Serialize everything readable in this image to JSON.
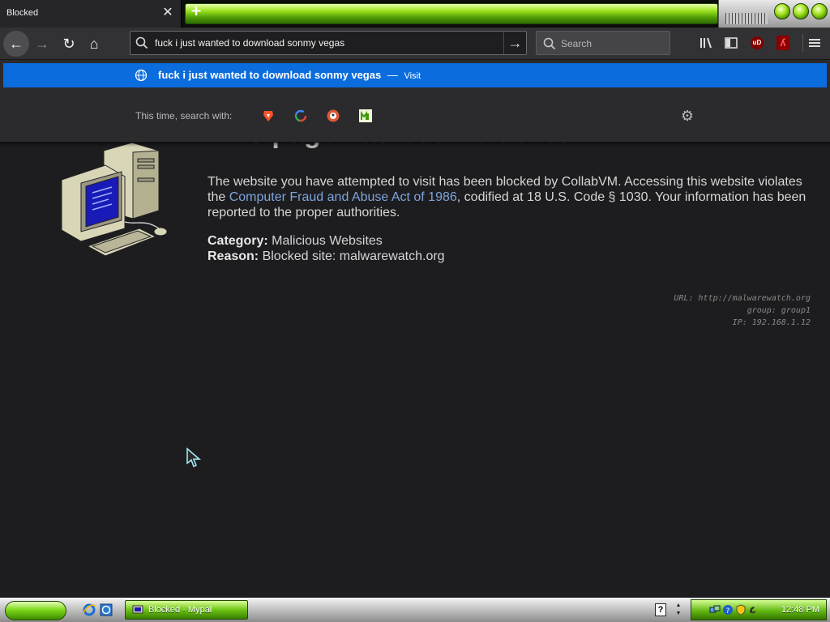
{
  "tab": {
    "title": "Blocked",
    "close": "✕",
    "new_tab": "+"
  },
  "nav": {
    "back": "←",
    "forward": "→",
    "reload": "↻",
    "home": "⌂"
  },
  "url_bar": {
    "value": "fuck i just wanted to download sonmy vegas",
    "go": "→"
  },
  "search_bar": {
    "placeholder": "Search"
  },
  "suggestion": {
    "text": "fuck i just wanted to download sonmy vegas",
    "separator": "—",
    "action": "Visit"
  },
  "one_off": {
    "label": "This time, search with:"
  },
  "page": {
    "title": "This page has been blocked",
    "para_1": "The website you have attempted to visit has been blocked by CollabVM. Accessing this website violates the",
    "link": "Computer Fraud and Abuse Act of 1986",
    "para_2": ", codified at 18 U.S. Code § 1030. Your information has been reported to the proper authorities.",
    "category_label": "Category:",
    "category_value": "Malicious Websites",
    "reason_label": "Reason:",
    "reason_value": "Blocked site: malwarewatch.org",
    "url_line": "URL: http://malwarewatch.org",
    "group_line": "group: group1",
    "ip_line": "IP: 192.168.1.12"
  },
  "taskbar": {
    "task_label": "Blocked - Mypal",
    "help": "?",
    "clock": "12:48 PM"
  },
  "colors": {
    "accent_blue": "#0a6cdd",
    "link_blue": "#7ea4dc",
    "lime": "#7ed81a",
    "background": "#1d1d1f"
  },
  "icons": {
    "library": "library-icon",
    "sidebar": "sidebar-icon",
    "ublock": "ublock-origin-icon",
    "extension": "red-extension-icon",
    "menu": "hamburger-menu-icon",
    "settings": "gear-icon"
  }
}
